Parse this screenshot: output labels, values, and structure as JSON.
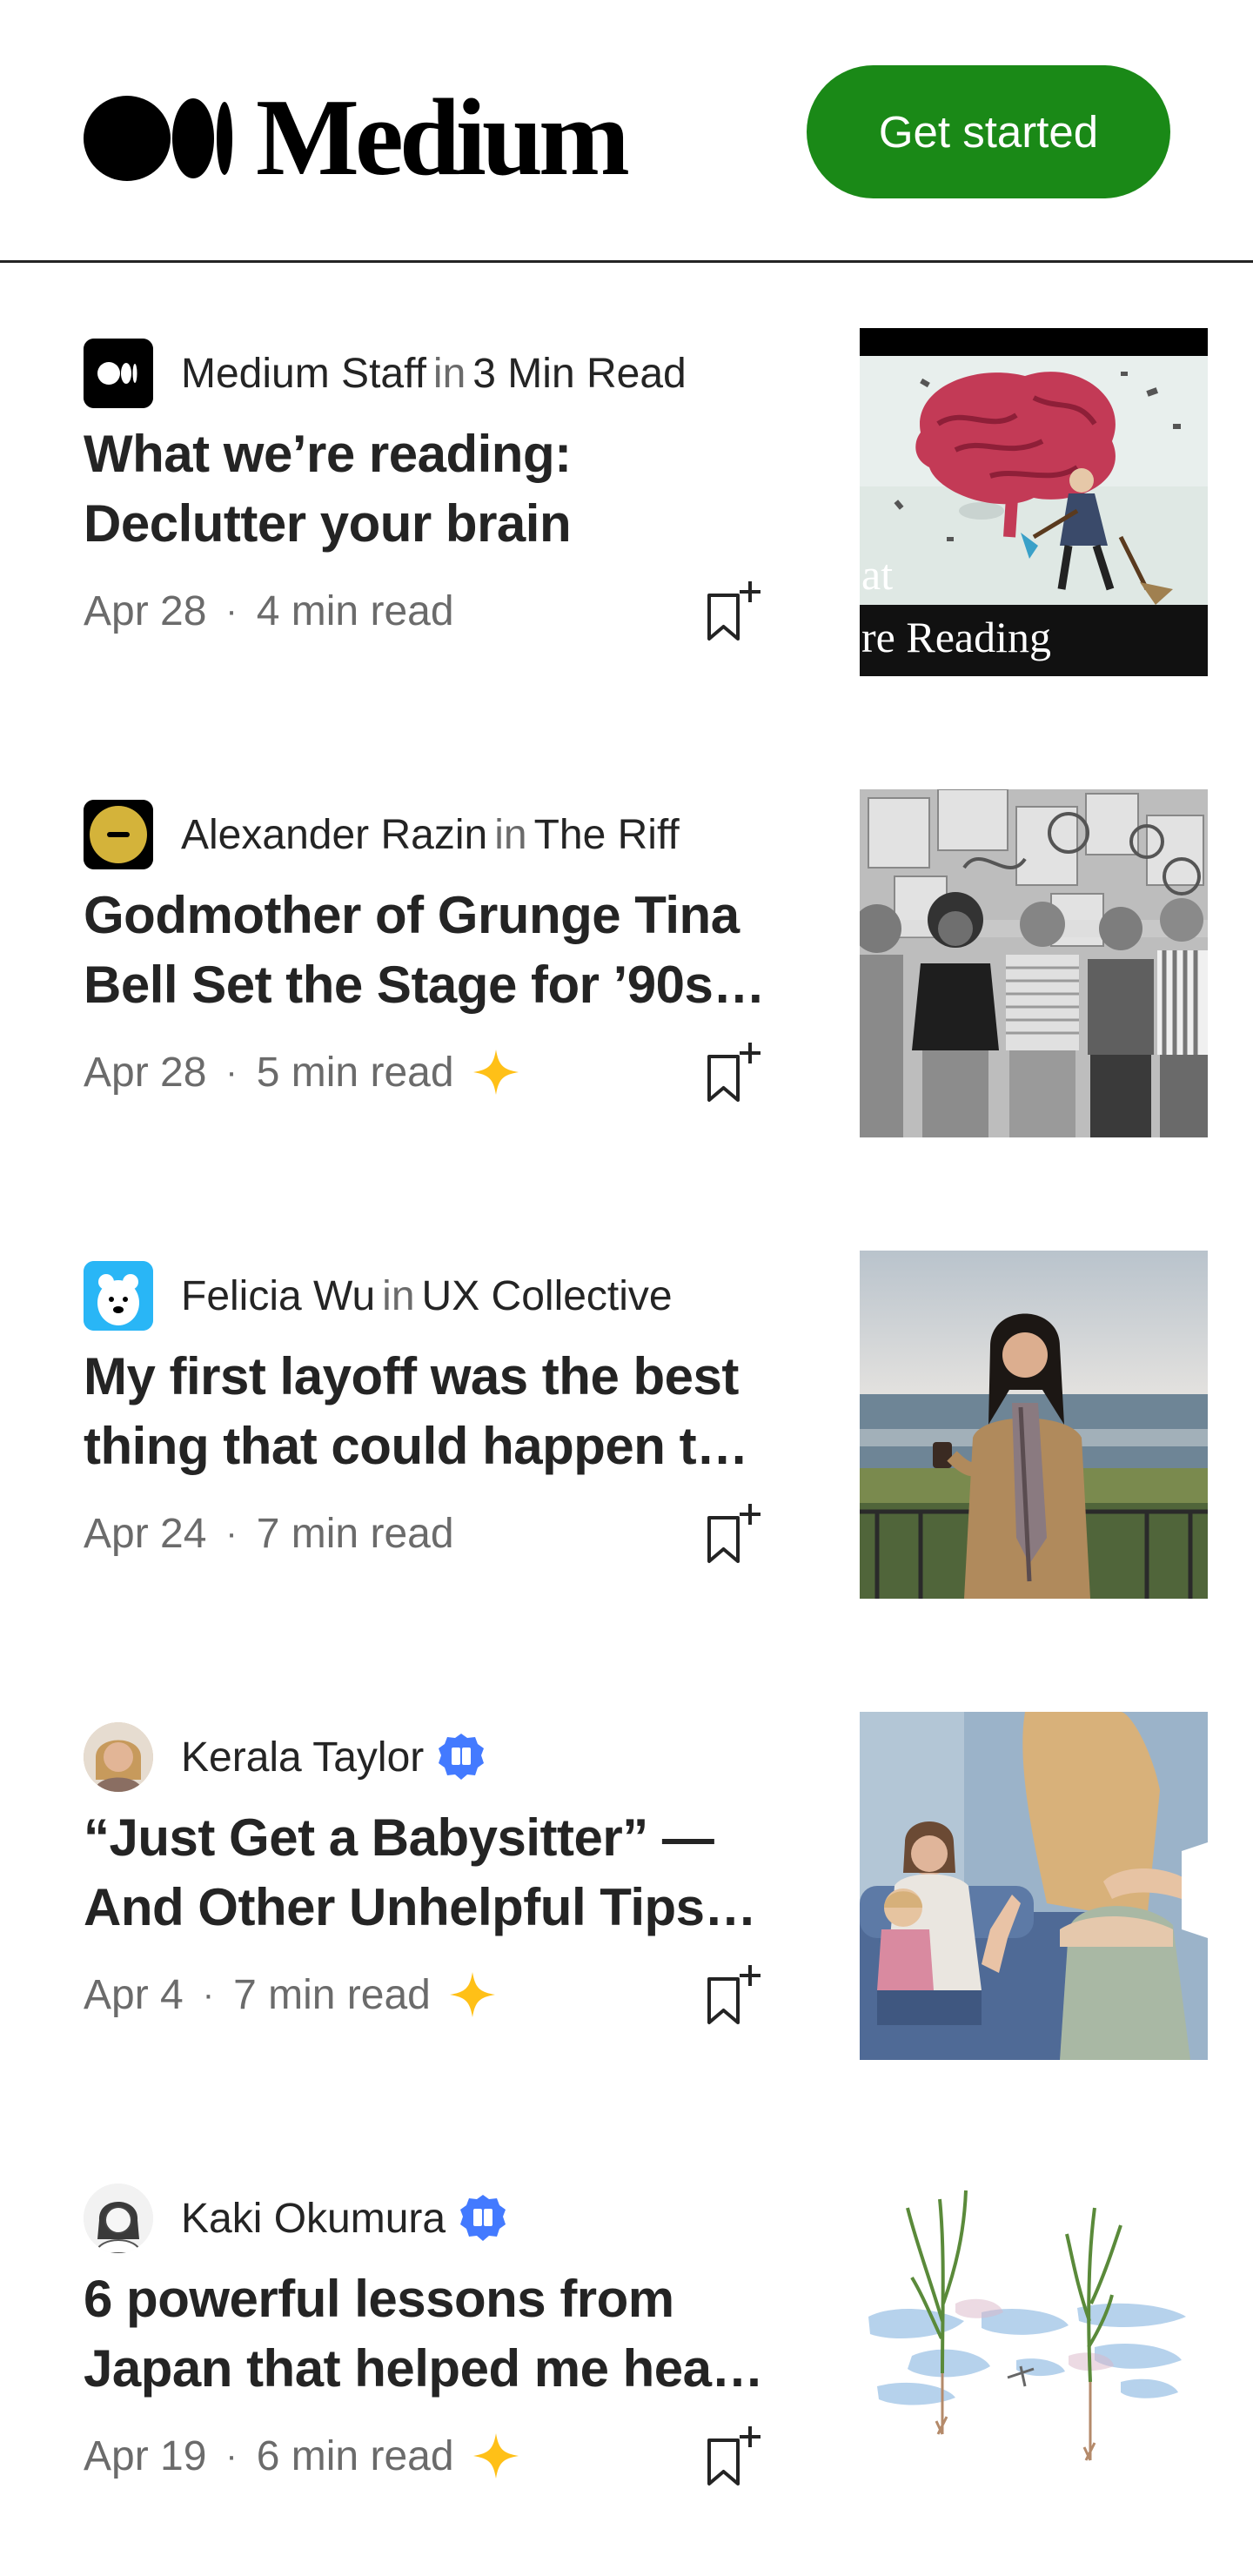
{
  "header": {
    "logo_text": "Medium",
    "cta_label": "Get started"
  },
  "articles": [
    {
      "author": "Medium Staff",
      "in_label": "in",
      "publication": "3 Min Read",
      "title": "What we’re reading: Declutter your brain",
      "date": "Apr 28",
      "read_time": "4 min read",
      "member_only": false,
      "verified": false,
      "thumb_caption_line1": "at",
      "thumb_caption_line2": "re Reading"
    },
    {
      "author": "Alexander Razin",
      "in_label": "in",
      "publication": "The Riff",
      "title": "Godmother of Grunge Tina Bell Set the Stage for ’90s…",
      "date": "Apr 28",
      "read_time": "5 min read",
      "member_only": true,
      "verified": false
    },
    {
      "author": "Felicia Wu",
      "in_label": "in",
      "publication": "UX Collective",
      "title": "My first layoff was the best thing that could happen t…",
      "date": "Apr 24",
      "read_time": "7 min read",
      "member_only": false,
      "verified": false
    },
    {
      "author": "Kerala Taylor",
      "in_label": "",
      "publication": "",
      "title": "“Just Get a Babysitter” — And Other Unhelpful Tips…",
      "date": "Apr 4",
      "read_time": "7 min read",
      "member_only": true,
      "verified": true
    },
    {
      "author": "Kaki Okumura",
      "in_label": "",
      "publication": "",
      "title": "6 powerful lessons from Japan that helped me hea…",
      "date": "Apr 19",
      "read_time": "6 min read",
      "member_only": true,
      "verified": true
    }
  ],
  "separator": "·",
  "icons": {
    "bookmark": "bookmark-add-icon",
    "member_star": "member-only-star-icon",
    "verified": "verified-badge-icon"
  },
  "colors": {
    "brand_green": "#1a8917",
    "text_primary": "#242424",
    "text_secondary": "#6b6b6b",
    "star_yellow": "#ffc017",
    "verified_blue": "#437aff"
  }
}
